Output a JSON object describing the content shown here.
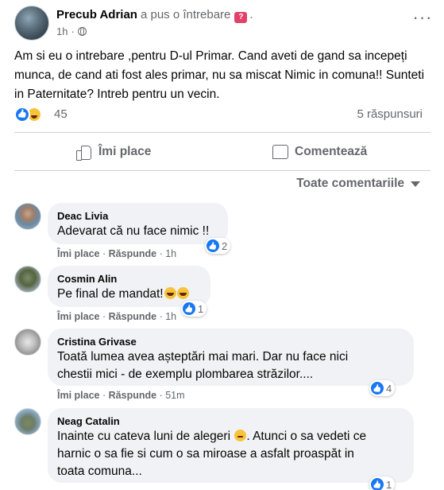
{
  "post": {
    "author": "Precub Adrian",
    "action": "a pus o întrebare",
    "badge": "?",
    "separator": ".",
    "time": "1h",
    "separator_dot": "·",
    "text": "Am si eu o intrebare ,pentru D-ul Primar. Cand aveti de gand sa incepeți munca, de cand ati fost ales primar, nu sa miscat Nimic in comuna!! Sunteti in Paternitate? Intreb pentru un vecin.",
    "reaction_count": "45",
    "answers": "5 răspunsuri",
    "reaction_icons": [
      "like-icon",
      "haha-icon"
    ]
  },
  "actions": {
    "like_label": "Îmi place",
    "comment_label": "Comentează"
  },
  "sort": {
    "label": "Toate comentariile"
  },
  "comment_actions": {
    "like": "Îmi place",
    "reply": "Răspunde",
    "sep": "·"
  },
  "comments": [
    {
      "name": "Deac Livia",
      "text": "Adevarat că nu face nimic !!",
      "reactions": "2",
      "time": "1h"
    },
    {
      "name": "Cosmin Alin",
      "text": "Pe final de mandat!",
      "reactions": "1",
      "time": "1h"
    },
    {
      "name": "Cristina Grivase",
      "line1": "Toată lumea avea așteptări mai mari. Dar nu face nici",
      "line2": "chestii mici - de exemplu plombarea străzilor....",
      "reactions": "4",
      "time": "51m"
    },
    {
      "name": "Neag Catalin",
      "line1a": "Inainte cu cateva luni de alegeri",
      "line1b": ". Atunci o sa vedeti ce",
      "line2": "harnic o sa fie si cum o sa miroase a asfalt proaspăt in",
      "line3": "toata comuna...",
      "reactions": "1"
    }
  ],
  "colors": {
    "accent": "#1877f2",
    "muted": "#65676b",
    "bubble": "#f0f2f5",
    "question_badge": "#e4416a"
  }
}
